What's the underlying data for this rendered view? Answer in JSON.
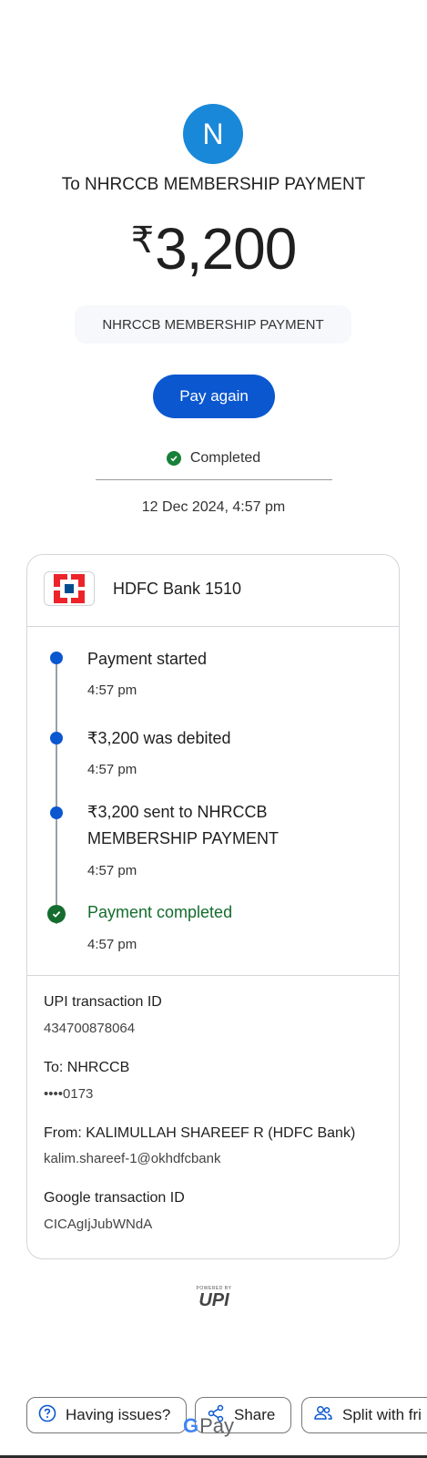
{
  "payee": {
    "avatar_letter": "N",
    "to_line": "To NHRCCB MEMBERSHIP PAYMENT",
    "currency": "₹",
    "amount": "3,200",
    "note": "NHRCCB MEMBERSHIP PAYMENT"
  },
  "actions": {
    "pay_again": "Pay again"
  },
  "status": {
    "label": "Completed",
    "date": "12 Dec 2024, 4:57 pm"
  },
  "bank": {
    "name": "HDFC Bank 1510"
  },
  "timeline": [
    {
      "title": "Payment started",
      "time": "4:57 pm"
    },
    {
      "title": "₹3,200 was debited",
      "time": "4:57 pm"
    },
    {
      "title_line1": "₹3,200 sent to NHRCCB",
      "title_line2": "MEMBERSHIP PAYMENT",
      "time": "4:57 pm"
    },
    {
      "title": "Payment completed",
      "time": "4:57 pm"
    }
  ],
  "details": {
    "upi_label": "UPI transaction ID",
    "upi_value": "434700878064",
    "to_label": "To: NHRCCB",
    "to_value": "••••0173",
    "from_label": "From: KALIMULLAH SHAREEF R (HDFC Bank)",
    "from_value": "kalim.shareef-1@okhdfcbank",
    "google_label": "Google transaction ID",
    "google_value": "CICAgIjJubWNdA"
  },
  "upi_logo": {
    "powered": "POWERED BY",
    "mark": "UPI"
  },
  "bottom": {
    "issues": "Having issues?",
    "share": "Share",
    "split": "Split with fri",
    "gpay_g": "G",
    "gpay_pay": "Pay"
  },
  "colors": {
    "accent": "#0b57d0",
    "success": "#188038",
    "avatar": "#1a88d8"
  }
}
